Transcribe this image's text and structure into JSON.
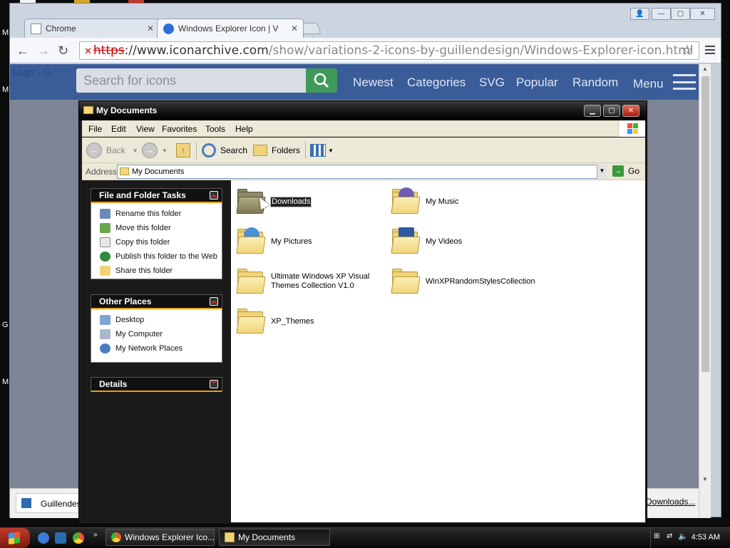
{
  "desktop": {
    "letters": [
      "M",
      "M",
      "G",
      "M"
    ]
  },
  "browser": {
    "tabs": [
      {
        "label": "Chrome",
        "active": false
      },
      {
        "label": "Windows Explorer Icon | Var",
        "active": true
      }
    ],
    "address": {
      "scheme": "https",
      "host": "://www.iconarchive.com",
      "path": "/show/variations-2-icons-by-guillendesign/Windows-Explorer-icon.html"
    },
    "site": {
      "logo_alt": "Logo - G",
      "search_placeholder": "Search for icons",
      "nav": [
        "Newest",
        "Categories",
        "SVG",
        "Popular",
        "Random",
        "Menu"
      ]
    },
    "downloads": {
      "left_item": "Guillendesig",
      "right_link": "Downloads..."
    }
  },
  "explorer": {
    "title": "My Documents",
    "menu": [
      "File",
      "Edit",
      "View",
      "Favorites",
      "Tools",
      "Help"
    ],
    "toolbar": {
      "back": "Back",
      "search": "Search",
      "folders": "Folders"
    },
    "address_label": "Address",
    "address_value": "My Documents",
    "go_label": "Go",
    "tasks": {
      "file_folder": {
        "title": "File and Folder Tasks",
        "items": [
          "Rename this folder",
          "Move this folder",
          "Copy this folder",
          "Publish this folder to the Web",
          "Share this folder"
        ]
      },
      "other_places": {
        "title": "Other Places",
        "items": [
          "Desktop",
          "My Computer",
          "My Network Places"
        ]
      },
      "details": {
        "title": "Details"
      }
    },
    "files": [
      {
        "name": "Downloads",
        "selected": true
      },
      {
        "name": "My Music",
        "selected": false
      },
      {
        "name": "My Pictures",
        "selected": false
      },
      {
        "name": "My Videos",
        "selected": false
      },
      {
        "name": "Ultimate Windows XP Visual Themes Collection V1.0",
        "selected": false
      },
      {
        "name": "WinXPRandomStylesCollection",
        "selected": false
      },
      {
        "name": "XP_Themes",
        "selected": false
      }
    ]
  },
  "taskbar": {
    "buttons": [
      {
        "label": "Windows Explorer Ico...",
        "active": false
      },
      {
        "label": "My Documents",
        "active": true
      }
    ],
    "clock": "4:53 AM"
  },
  "colors": {
    "accent_orange": "#f19b1a",
    "site_bar": "#3a5c99",
    "search_green": "#3f9a5a"
  }
}
